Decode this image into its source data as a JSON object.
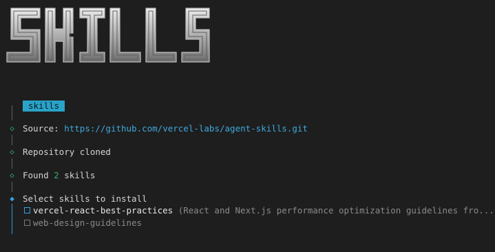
{
  "logo": {
    "text": "SKILLS"
  },
  "header": {
    "badge": "skills"
  },
  "steps": {
    "source_label": "Source:",
    "source_url": "https://github.com/vercel-labs/agent-skills.git",
    "cloned": "Repository cloned",
    "found_prefix": "Found",
    "found_count": "2",
    "found_suffix": "skills",
    "select_prompt": "Select skills to install"
  },
  "options": [
    {
      "label": "vercel-react-best-practices",
      "hint": "(React and Next.js performance optimization guidelines fro...)"
    },
    {
      "label": "web-design-guidelines"
    }
  ],
  "colors": {
    "background": "#1e1e1e",
    "accent": "#2aa3c8",
    "link": "#3fa8dd",
    "success": "#2fb36b",
    "active": "#3aa0e8"
  },
  "icons": {
    "step_done": "diamond-outline-icon",
    "step_active": "diamond-filled-icon",
    "checkbox": "checkbox-empty-icon"
  }
}
